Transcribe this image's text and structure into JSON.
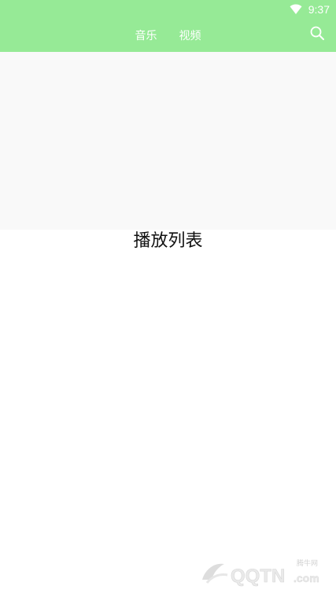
{
  "status_bar": {
    "time": "9:37",
    "icons": [
      "wifi-icon"
    ]
  },
  "top_bar": {
    "tabs": [
      {
        "label": "音乐"
      },
      {
        "label": "视频"
      }
    ],
    "search_icon": "search-icon"
  },
  "content": {
    "playlist_title": "播放列表"
  },
  "watermark": {
    "brand_text": "QQTN",
    "domain_suffix": ".com",
    "chinese_label": "腾牛网"
  },
  "colors": {
    "accent_green": "#96ea96",
    "player_bg": "#f9f9f9"
  }
}
